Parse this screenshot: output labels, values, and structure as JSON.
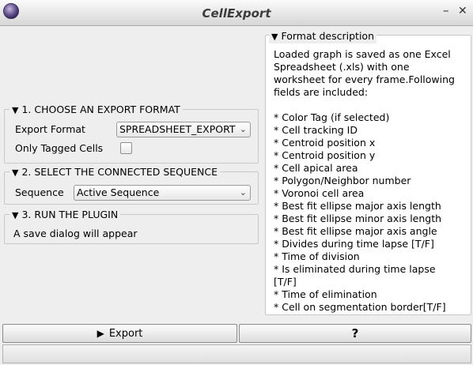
{
  "window": {
    "title": "CellExport",
    "icon": "app-logo-icon",
    "minimize_icon": "minimize-icon",
    "close_icon": "close-icon"
  },
  "sections": {
    "export_format": {
      "header": "1. CHOOSE AN EXPORT FORMAT",
      "format_label": "Export Format",
      "format_value": "SPREADSHEET_EXPORT",
      "tagged_label": "Only Tagged Cells",
      "tagged_checked": false
    },
    "sequence": {
      "header": "2. SELECT THE CONNECTED SEQUENCE",
      "sequence_label": "Sequence",
      "sequence_value": "Active Sequence"
    },
    "run": {
      "header": "3. RUN THE PLUGIN",
      "text": "A save dialog will appear"
    }
  },
  "description": {
    "header": "Format description",
    "lines": [
      "Loaded graph is saved as one Excel",
      "Spreadsheet (.xls) with one",
      "worksheet for every frame.Following",
      "fields are included:",
      "",
      "* Color Tag (if selected)",
      "* Cell tracking ID",
      "* Centroid position x",
      "* Centroid position y",
      "* Cell apical area",
      "* Polygon/Neighbor number",
      "* Voronoi cell area",
      "* Best fit ellipse major axis length",
      "* Best fit ellipse minor axis length",
      "* Best fit ellipse major axis angle",
      "* Divides during time lapse [T/F]",
      "* Time of division",
      "* Is eliminated during time lapse",
      "[T/F]",
      "* Time of elimination",
      "* Cell on segmentation border[T/F]"
    ]
  },
  "buttons": {
    "export": "Export",
    "help": "?"
  },
  "colors": {
    "background": "#eeeeee",
    "panel": "#ffffff",
    "border": "#c8c8c8"
  }
}
